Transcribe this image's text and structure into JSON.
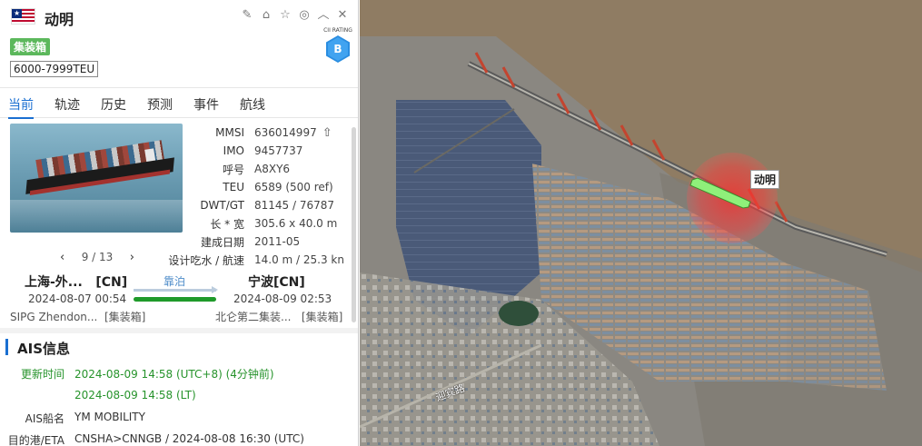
{
  "header": {
    "ship_name": "动明",
    "type_badge": "集装箱",
    "teu_badge": "6000-7999TEU",
    "cii_label": "CII RATING",
    "cii_grade": "B",
    "icons": [
      "edit-icon",
      "tag-icon",
      "star-icon",
      "target-icon",
      "collapse-icon",
      "close-icon"
    ]
  },
  "tabs": [
    "当前",
    "轨迹",
    "历史",
    "预测",
    "事件",
    "航线"
  ],
  "specs": [
    {
      "k": "MMSI",
      "v": "636014997"
    },
    {
      "k": "IMO",
      "v": "9457737"
    },
    {
      "k": "呼号",
      "v": "A8XY6"
    },
    {
      "k": "TEU",
      "v": "6589 (500 ref)"
    },
    {
      "k": "DWT/GT",
      "v": "81145 / 76787"
    },
    {
      "k": "长 * 宽",
      "v": "305.6 x 40.0 m"
    },
    {
      "k": "建成日期",
      "v": "2011-05"
    },
    {
      "k": "设计吃水 / 航速",
      "v": "14.0 m / 25.3 kn"
    }
  ],
  "pager": {
    "text": "9 / 13",
    "prev": "‹",
    "next": "›"
  },
  "route": {
    "from_port": "上海-外...   [CN]",
    "to_port": "宁波[CN]",
    "status": "靠泊",
    "from_time": "2024-08-07 00:54",
    "to_time": "2024-08-09 02:53",
    "from_terminal": "SIPG Zhendon...  [集装箱]",
    "to_terminal": "北仑第二集装...   [集装箱]",
    "progress": 1.0
  },
  "ais": {
    "title": "AIS信息",
    "rows": [
      {
        "k": "更新时间",
        "v": "2024-08-09 14:58 (UTC+8) (4分钟前)",
        "green": true
      },
      {
        "k": "",
        "v": "2024-08-09 14:58 (LT)",
        "green": true
      },
      {
        "k": "AIS船名",
        "v": "YM MOBILITY",
        "green": false
      },
      {
        "k": "目的港/ETA",
        "v": "CNSHA>CNNGB / 2024-08-08 16:30 (UTC)",
        "green": false
      }
    ]
  },
  "map": {
    "ship_label": "动明",
    "road_label": "迎宾路"
  }
}
